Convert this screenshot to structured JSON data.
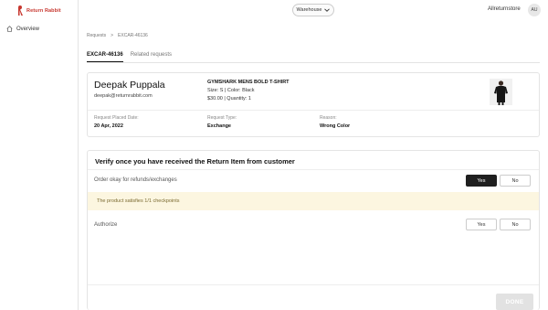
{
  "brand": {
    "name": "Return Rabbit",
    "color": "#c7372f"
  },
  "sidebar": {
    "items": [
      {
        "label": "Overview",
        "icon": "home-icon"
      }
    ]
  },
  "topbar": {
    "warehouse_label": "Warehouse",
    "store_name": "Allreturnstore",
    "avatar_initials": "AU"
  },
  "breadcrumb": {
    "root": "Requests",
    "separator": ">",
    "current": "EXCAR-46136"
  },
  "tabs": [
    {
      "label": "EXCAR-46136",
      "active": true
    },
    {
      "label": "Related requests",
      "active": false
    }
  ],
  "customer": {
    "name": "Deepak Puppala",
    "email": "deepak@returnrabbit.com"
  },
  "product": {
    "name": "GYMSHARK MENS BOLD T-SHIRT",
    "variant": "Size: S | Color: Black",
    "price_qty": "$30.00 | Quantity: 1"
  },
  "meta": {
    "placed_label": "Request Placed Date:",
    "placed_value": "20 Apr, 2022",
    "type_label": "Request Type:",
    "type_value": "Exchange",
    "reason_label": "Reason:",
    "reason_value": "Wrong Color"
  },
  "verify": {
    "title": "Verify once you have received the Return Item from customer",
    "order_label": "Order okay for refunds/exchanges",
    "yes_label": "Yes",
    "no_label": "No",
    "banner_text": "The product satisfies 1/1 checkpoints",
    "authorize_label": "Authorize",
    "done_label": "DONE"
  }
}
